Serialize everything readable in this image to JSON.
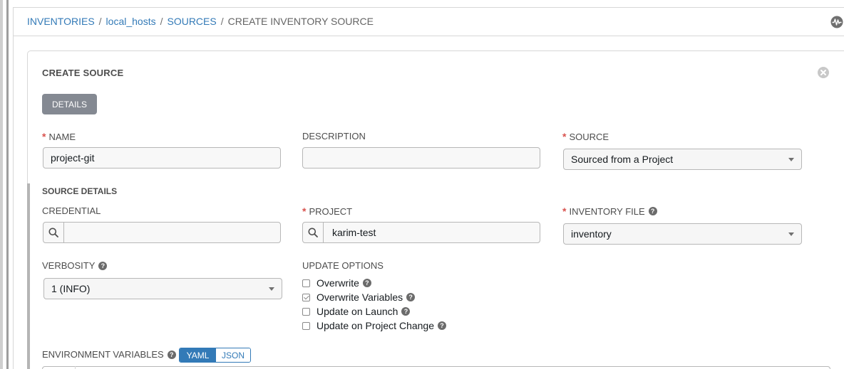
{
  "breadcrumb": {
    "items": [
      "INVENTORIES",
      "local_hosts",
      "SOURCES"
    ],
    "separator": "/",
    "current": "CREATE INVENTORY SOURCE"
  },
  "header_icons": {
    "activity": "activity-stream-icon"
  },
  "panel": {
    "title": "CREATE SOURCE",
    "close_icon": "close-circle-icon",
    "tabs": [
      {
        "label": "DETAILS",
        "active": true
      }
    ]
  },
  "form": {
    "required_marker": "*",
    "help_glyph": "?",
    "name": {
      "label": "NAME",
      "value": "project-git",
      "required": true
    },
    "description": {
      "label": "DESCRIPTION",
      "value": ""
    },
    "source": {
      "label": "SOURCE",
      "value": "Sourced from a Project",
      "required": true
    }
  },
  "source_details": {
    "title": "SOURCE DETAILS",
    "credential": {
      "label": "CREDENTIAL",
      "value": "",
      "icon": "search-icon"
    },
    "project": {
      "label": "PROJECT",
      "value": "karim-test",
      "required": true,
      "icon": "search-icon"
    },
    "inventory_file": {
      "label": "INVENTORY FILE",
      "value": "inventory",
      "required": true
    },
    "verbosity": {
      "label": "VERBOSITY",
      "value": "1 (INFO)"
    },
    "update_options": {
      "label": "UPDATE OPTIONS",
      "options": [
        {
          "label": "Overwrite",
          "checked": false
        },
        {
          "label": "Overwrite Variables",
          "checked": true
        },
        {
          "label": "Update on Launch",
          "checked": false
        },
        {
          "label": "Update on Project Change",
          "checked": false
        }
      ]
    },
    "environment_variables": {
      "label": "ENVIRONMENT VARIABLES",
      "modes": [
        "YAML",
        "JSON"
      ],
      "selected": "YAML"
    }
  },
  "colors": {
    "link": "#337ab7",
    "required": "#d9534f",
    "tab_bg": "#848992",
    "toggle_active": "#337ab7"
  }
}
